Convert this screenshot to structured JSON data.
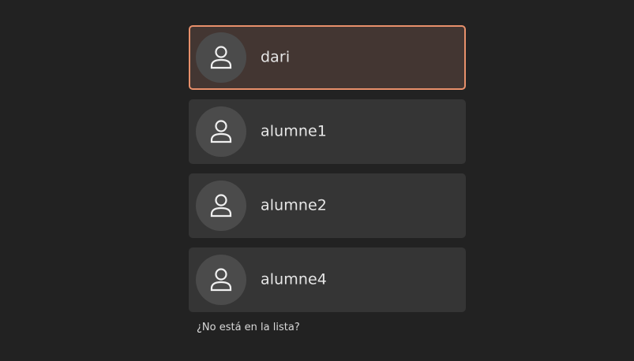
{
  "users": [
    {
      "name": "dari",
      "icon": "user-avatar-icon",
      "selected": true
    },
    {
      "name": "alumne1",
      "icon": "user-avatar-icon",
      "selected": false
    },
    {
      "name": "alumne2",
      "icon": "user-avatar-icon",
      "selected": false
    },
    {
      "name": "alumne4",
      "icon": "user-avatar-icon",
      "selected": false
    }
  ],
  "not_listed_label": "¿No está en la lista?",
  "colors": {
    "background": "#222222",
    "item_background": "#353535",
    "selected_background": "#433632",
    "selected_border": "#e8906b",
    "avatar_background": "#4b4b4b"
  }
}
